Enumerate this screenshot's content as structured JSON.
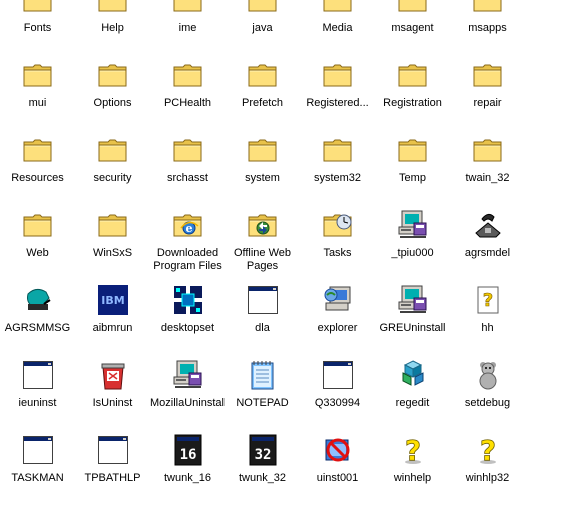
{
  "items": [
    {
      "label": "Fonts",
      "icon": "folder-icon"
    },
    {
      "label": "Help",
      "icon": "folder-icon"
    },
    {
      "label": "ime",
      "icon": "folder-icon"
    },
    {
      "label": "java",
      "icon": "folder-icon"
    },
    {
      "label": "Media",
      "icon": "folder-icon"
    },
    {
      "label": "msagent",
      "icon": "folder-icon"
    },
    {
      "label": "msapps",
      "icon": "folder-icon"
    },
    {
      "label": "mui",
      "icon": "folder-icon"
    },
    {
      "label": "Options",
      "icon": "folder-icon"
    },
    {
      "label": "PCHealth",
      "icon": "folder-icon"
    },
    {
      "label": "Prefetch",
      "icon": "folder-icon"
    },
    {
      "label": "Registered...",
      "icon": "folder-icon"
    },
    {
      "label": "Registration",
      "icon": "folder-icon"
    },
    {
      "label": "repair",
      "icon": "folder-icon"
    },
    {
      "label": "Resources",
      "icon": "folder-icon"
    },
    {
      "label": "security",
      "icon": "folder-icon"
    },
    {
      "label": "srchasst",
      "icon": "folder-icon"
    },
    {
      "label": "system",
      "icon": "folder-icon"
    },
    {
      "label": "system32",
      "icon": "folder-icon"
    },
    {
      "label": "Temp",
      "icon": "folder-icon"
    },
    {
      "label": "twain_32",
      "icon": "folder-icon"
    },
    {
      "label": "Web",
      "icon": "folder-icon"
    },
    {
      "label": "WinSxS",
      "icon": "folder-icon"
    },
    {
      "label": "Downloaded\nProgram Files",
      "icon": "ie-folder-icon"
    },
    {
      "label": "Offline Web\nPages",
      "icon": "offline-folder-icon"
    },
    {
      "label": "Tasks",
      "icon": "tasks-folder-icon"
    },
    {
      "label": "_tpiu000",
      "icon": "installer-computer-icon"
    },
    {
      "label": "agrsmdel",
      "icon": "phone-icon"
    },
    {
      "label": "AGRSMMSG",
      "icon": "agrsmmsg-icon"
    },
    {
      "label": "aibmrun",
      "icon": "ibm-icon"
    },
    {
      "label": "desktopset",
      "icon": "desktopset-icon"
    },
    {
      "label": "dla",
      "icon": "app-window-icon"
    },
    {
      "label": "explorer",
      "icon": "explorer-computer-icon"
    },
    {
      "label": "GREUninstall",
      "icon": "installer-computer-icon"
    },
    {
      "label": "hh",
      "icon": "help-document-icon"
    },
    {
      "label": "ieuninst",
      "icon": "app-window-icon"
    },
    {
      "label": "IsUninst",
      "icon": "uninstall-bin-icon"
    },
    {
      "label": "MozillaUninstall",
      "icon": "installer-computer-icon"
    },
    {
      "label": "NOTEPAD",
      "icon": "notepad-icon"
    },
    {
      "label": "Q330994",
      "icon": "app-window-icon"
    },
    {
      "label": "regedit",
      "icon": "regedit-icon"
    },
    {
      "label": "setdebug",
      "icon": "teddy-bear-icon"
    },
    {
      "label": "TASKMAN",
      "icon": "app-window-icon"
    },
    {
      "label": "TPBATHLP",
      "icon": "app-window-icon"
    },
    {
      "label": "twunk_16",
      "icon": "twunk-16-icon"
    },
    {
      "label": "twunk_32",
      "icon": "twunk-32-icon"
    },
    {
      "label": "uinst001",
      "icon": "uninstall-no-icon"
    },
    {
      "label": "winhelp",
      "icon": "help-question-icon"
    },
    {
      "label": "winhlp32",
      "icon": "help-question-icon"
    }
  ]
}
